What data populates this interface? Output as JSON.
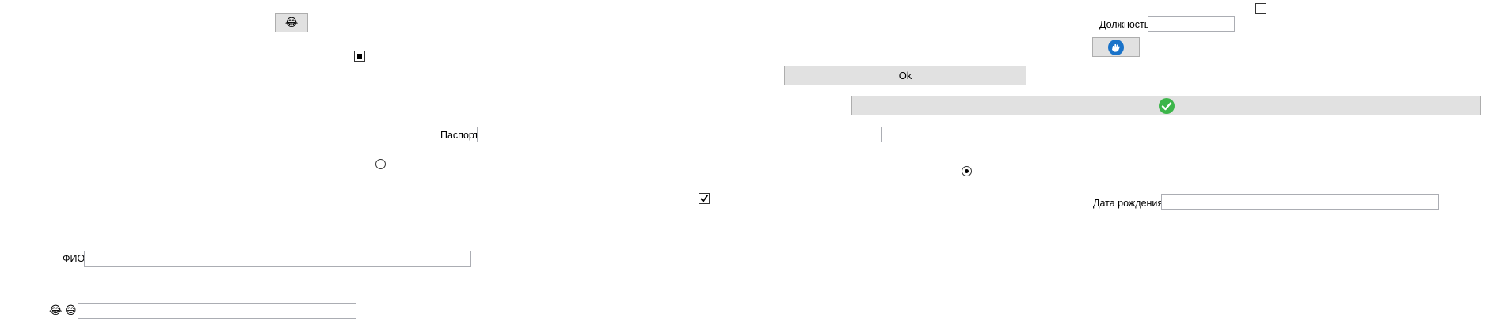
{
  "buttons": {
    "emoji_button_glyph": "😂",
    "ok_label": "Ok",
    "hand_icon": "hand-wave-icon",
    "check_icon": "green-check-circle-icon"
  },
  "fields": {
    "position_label": "Должность",
    "passport_label": "Паспорт",
    "birth_date_label": "Дата рождения",
    "fio_label": "ФИО",
    "position_value": "",
    "passport_value": "",
    "birth_date_value": "",
    "fio_value": "",
    "emoji_field_value": ""
  },
  "emoji_label": {
    "first": "😂",
    "second": "😄"
  },
  "checkboxes": {
    "top_right_checked": false,
    "square_indeterminate": true,
    "middle_checked": true
  },
  "radios": {
    "left_selected": false,
    "right_selected": true
  },
  "colors": {
    "button_bg": "#e1e1e1",
    "button_border": "#adadad",
    "check_green": "#3cb54a",
    "hand_blue": "#1a73c9",
    "field_border": "#abadb3"
  }
}
